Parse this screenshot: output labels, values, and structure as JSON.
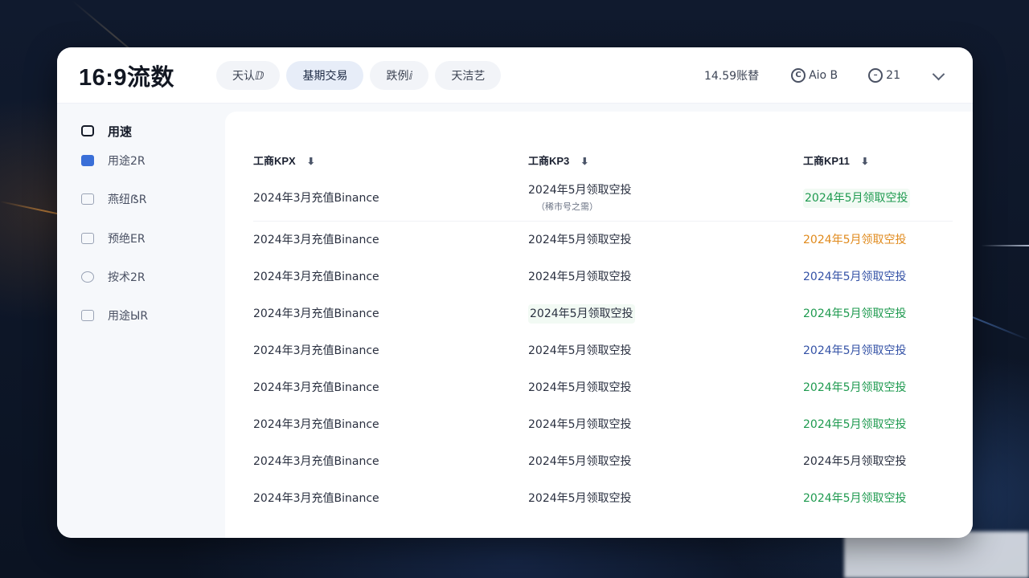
{
  "app": {
    "title": "16:9流数"
  },
  "tabs": [
    {
      "label": "天认ⅅ",
      "active": false
    },
    {
      "label": "基期交易",
      "active": true
    },
    {
      "label": "跌例ⅈ",
      "active": false
    },
    {
      "label": "天洁艺",
      "active": false
    }
  ],
  "topright": {
    "balance": "14.59账替",
    "account_label": "Aio B",
    "count_label": "21"
  },
  "sidebar": {
    "items": [
      {
        "label": "用速",
        "icon": "square-icon"
      },
      {
        "label": "用途2R",
        "icon": "download-icon"
      },
      {
        "label": "燕纽ẞR",
        "icon": "mail-icon"
      },
      {
        "label": "预绝ER",
        "icon": "mail-icon"
      },
      {
        "label": "按术2R",
        "icon": "clock-icon"
      },
      {
        "label": "用途ЫR",
        "icon": "check-icon"
      }
    ]
  },
  "table": {
    "headers": [
      "工商KPX",
      "工商KP3",
      "工商KP11"
    ],
    "sub_note": "（稀市号之需）",
    "rows": [
      [
        "2024年3月充值Binance",
        "2024年5月领取空投",
        "2024年5月领取空投"
      ],
      [
        "2024年3月充值Binance",
        "2024年5月领取空投",
        "2024年5月领取空投"
      ],
      [
        "2024年3月充值Binance",
        "2024年5月领取空投",
        "2024年5月领取空投"
      ],
      [
        "2024年3月充值Binance",
        "2024年5月领取空投",
        "2024年5月领取空投"
      ],
      [
        "2024年3月充值Binance",
        "2024年5月领取空投",
        "2024年5月领取空投"
      ],
      [
        "2024年3月充值Binance",
        "2024年5月领取空投",
        "2024年5月领取空投"
      ],
      [
        "2024年3月充值Binance",
        "2024年5月领取空投",
        "2024年5月领取空投"
      ],
      [
        "2024年3月充值Binance",
        "2024年5月领取空投",
        "2024年5月领取空投"
      ],
      [
        "2024年3月充值Binance",
        "2024年5月领取空投",
        "2024年5月领取空投"
      ]
    ],
    "status_colors": {
      "green": "#1e9a4f",
      "orange": "#e08a1c",
      "blue": "#3452a6",
      "dark": "#2a3040"
    }
  }
}
